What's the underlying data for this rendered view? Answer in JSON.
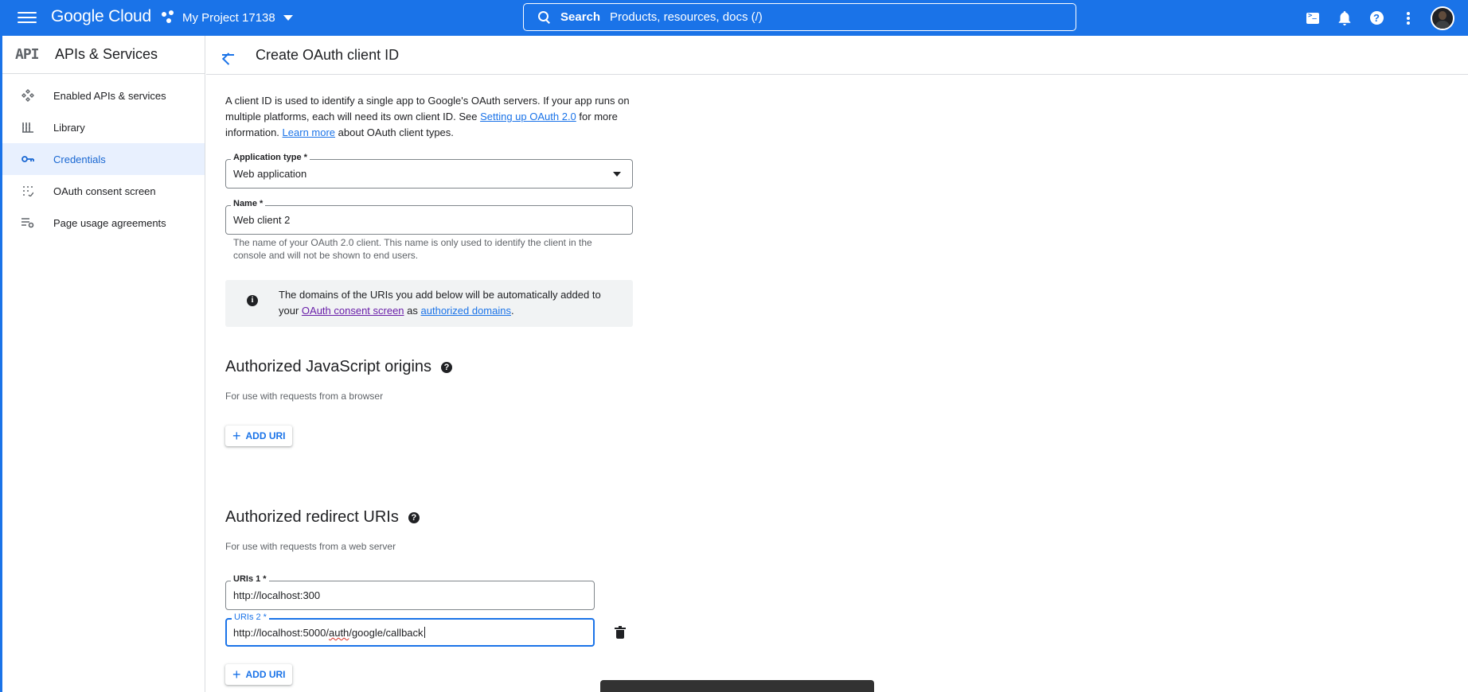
{
  "topbar": {
    "logo": "Google Cloud",
    "project": "My Project 17138",
    "search_label": "Search",
    "search_placeholder": "Products, resources, docs (/)",
    "icons": [
      "terminal-icon",
      "bell-icon",
      "help-icon",
      "more-vert-icon",
      "avatar"
    ]
  },
  "sidebar": {
    "logo_text": "API",
    "title": "APIs & Services",
    "items": [
      {
        "label": "Enabled APIs & services",
        "icon": "enabled-apis-icon",
        "active": false
      },
      {
        "label": "Library",
        "icon": "library-icon",
        "active": false
      },
      {
        "label": "Credentials",
        "icon": "key-icon",
        "active": true
      },
      {
        "label": "OAuth consent screen",
        "icon": "consent-screen-icon",
        "active": false
      },
      {
        "label": "Page usage agreements",
        "icon": "agreements-icon",
        "active": false
      }
    ]
  },
  "main": {
    "title": "Create OAuth client ID",
    "intro": {
      "part1": "A client ID is used to identify a single app to Google's OAuth servers. If your app runs on multiple platforms, each will need its own client ID. See ",
      "link1": "Setting up OAuth 2.0",
      "part2": " for more information. ",
      "link2": "Learn more",
      "part3": " about OAuth client types."
    },
    "app_type": {
      "label": "Application type *",
      "value": "Web application"
    },
    "name": {
      "label": "Name *",
      "value": "Web client 2",
      "helper": "The name of your OAuth 2.0 client. This name is only used to identify the client in the console and will not be shown to end users."
    },
    "note": {
      "part1": "The domains of the URIs you add below will be automatically added to your ",
      "link1": "OAuth consent screen",
      "part2": " as ",
      "link2": "authorized domains",
      "part3": "."
    },
    "js_origins": {
      "title": "Authorized JavaScript origins",
      "subtitle": "For use with requests from a browser",
      "add_label": "ADD URI"
    },
    "redirect_uris": {
      "title": "Authorized redirect URIs",
      "subtitle": "For use with requests from a web server",
      "uri1": {
        "label": "URIs 1 *",
        "value": "http://localhost:300"
      },
      "uri2": {
        "label": "URIs 2 *",
        "value_pre": "http://localhost:5000/",
        "value_spell": "auth",
        "value_post": "/google/callback"
      },
      "add_label": "ADD URI"
    }
  },
  "colors": {
    "brand": "#1a73e8",
    "active_bg": "#e8f0fe",
    "text": "#202124",
    "muted": "#5f6368"
  }
}
